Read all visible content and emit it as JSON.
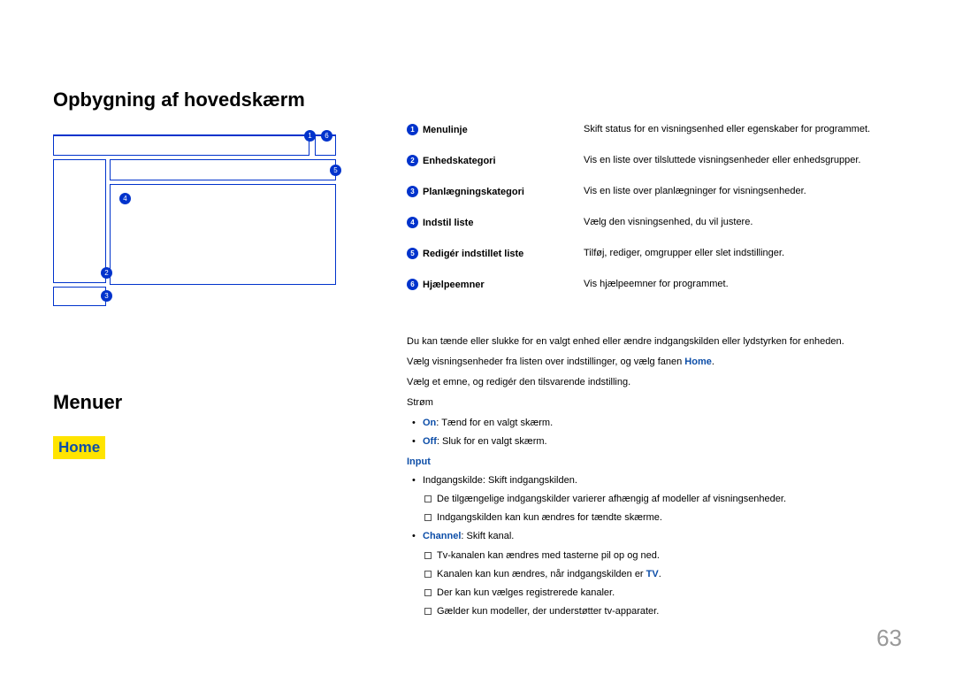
{
  "h1": "Opbygning af hovedskærm",
  "h2": "Menuer",
  "homeTag": "Home",
  "legend": [
    {
      "n": "1",
      "label": "Menulinje",
      "desc": "Skift status for en visningsenhed eller egenskaber for programmet."
    },
    {
      "n": "2",
      "label": "Enhedskategori",
      "desc": "Vis en liste over tilsluttede visningsenheder eller enhedsgrupper."
    },
    {
      "n": "3",
      "label": "Planlægningskategori",
      "desc": "Vis en liste over planlægninger for visningsenheder."
    },
    {
      "n": "4",
      "label": "Indstil liste",
      "desc": "Vælg den visningsenhed, du vil justere."
    },
    {
      "n": "5",
      "label": "Redigér indstillet liste",
      "desc": "Tilføj, rediger, omgrupper eller slet indstillinger."
    },
    {
      "n": "6",
      "label": "Hjælpeemner",
      "desc": "Vis hjælpeemner for programmet."
    }
  ],
  "body": {
    "p1": "Du kan tænde eller slukke for en valgt enhed eller ændre indgangskilden eller lydstyrken for enheden.",
    "p2_a": "Vælg visningsenheder fra listen over indstillinger, og vælg fanen ",
    "p2_b": "Home",
    "p2_c": ".",
    "p3": "Vælg et emne, og redigér den tilsvarende indstilling.",
    "stromHeader": "Strøm",
    "strom_on_b": "On",
    "strom_on_t": ": Tænd for en valgt skærm.",
    "strom_off_b": "Off",
    "strom_off_t": ": Sluk for en valgt skærm.",
    "inputHeader": "Input",
    "input1": "Indgangskilde: Skift indgangskilden.",
    "input1_sub1": "De tilgængelige indgangskilder varierer afhængig af modeller af visningsenheder.",
    "input1_sub2": "Indgangskilden kan kun ændres for tændte skærme.",
    "input2_b": "Channel",
    "input2_t": ": Skift kanal.",
    "input2_sub1": "Tv-kanalen kan ændres med tasterne pil op og ned.",
    "input2_sub2_a": "Kanalen kan kun ændres, når indgangskilden er ",
    "input2_sub2_b": "TV",
    "input2_sub2_c": ".",
    "input2_sub3": "Der kan kun vælges registrerede kanaler.",
    "input2_sub4": "Gælder kun modeller, der understøtter tv-apparater."
  },
  "pageNumber": "63",
  "diagBadges": {
    "b1": "1",
    "b2": "2",
    "b3": "3",
    "b4": "4",
    "b5": "5",
    "b6": "6"
  }
}
